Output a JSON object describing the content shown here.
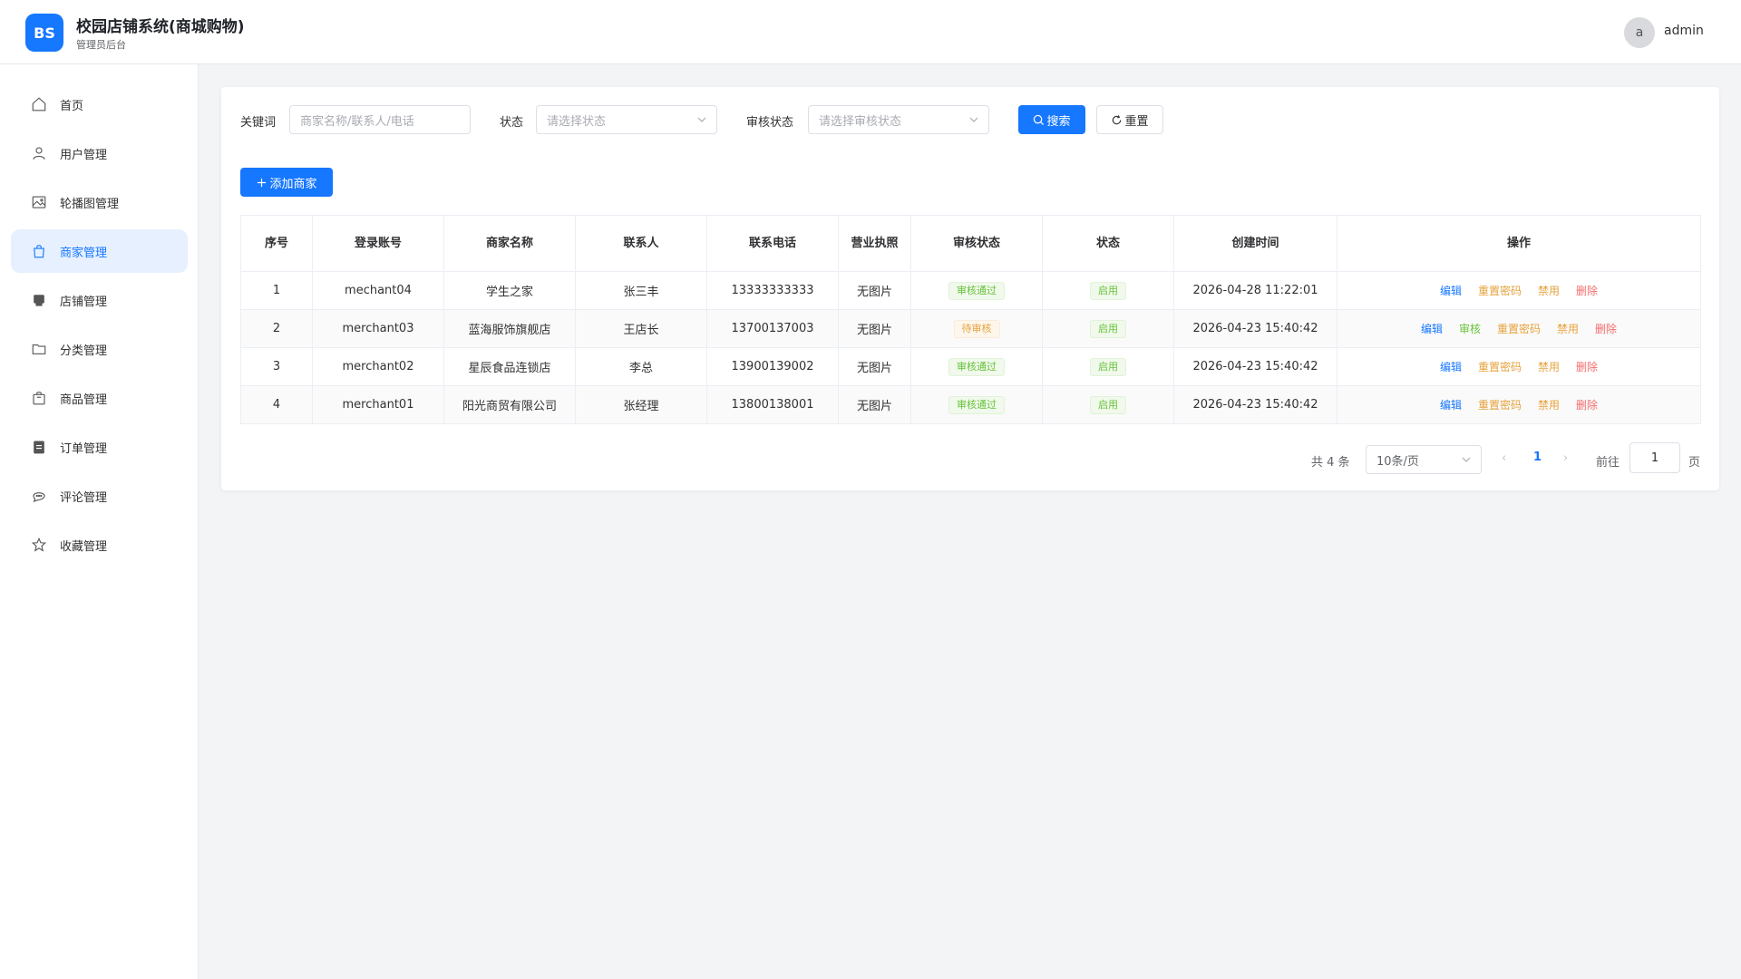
{
  "header": {
    "logo_text": "BS",
    "title": "校园店铺系统(商城购物)",
    "subtitle": "管理员后台",
    "avatar_letter": "a",
    "username": "admin"
  },
  "sidebar": {
    "items": [
      {
        "label": "首页",
        "icon": "home-icon"
      },
      {
        "label": "用户管理",
        "icon": "user-icon"
      },
      {
        "label": "轮播图管理",
        "icon": "image-icon"
      },
      {
        "label": "商家管理",
        "icon": "shopping-bag-icon",
        "active": true
      },
      {
        "label": "店铺管理",
        "icon": "shop-icon"
      },
      {
        "label": "分类管理",
        "icon": "folder-icon"
      },
      {
        "label": "商品管理",
        "icon": "goods-icon"
      },
      {
        "label": "订单管理",
        "icon": "clipboard-icon"
      },
      {
        "label": "评论管理",
        "icon": "chat-icon"
      },
      {
        "label": "收藏管理",
        "icon": "star-icon"
      }
    ]
  },
  "filters": {
    "keyword_label": "关键词",
    "keyword_placeholder": "商家名称/联系人/电话",
    "status_label": "状态",
    "status_placeholder": "请选择状态",
    "audit_label": "审核状态",
    "audit_placeholder": "请选择审核状态",
    "search_label": "搜索",
    "reset_label": "重置"
  },
  "add_button": "添加商家",
  "table": {
    "headers": [
      "序号",
      "登录账号",
      "商家名称",
      "联系人",
      "联系电话",
      "营业执照",
      "审核状态",
      "状态",
      "创建时间",
      "操作"
    ],
    "rows": [
      {
        "index": "1",
        "account": "mechant04",
        "name": "学生之家",
        "contact": "张三丰",
        "phone": "13333333333",
        "license": "无图片",
        "audit": "审核通过",
        "status": "启用",
        "created": "2026-04-28 11:22:01",
        "ops": [
          "编辑",
          "重置密码",
          "禁用",
          "删除"
        ]
      },
      {
        "index": "2",
        "account": "merchant03",
        "name": "蓝海服饰旗舰店",
        "contact": "王店长",
        "phone": "13700137003",
        "license": "无图片",
        "audit": "待审核",
        "status": "启用",
        "created": "2026-04-23 15:40:42",
        "ops": [
          "编辑",
          "审核",
          "重置密码",
          "禁用",
          "删除"
        ]
      },
      {
        "index": "3",
        "account": "merchant02",
        "name": "星辰食品连锁店",
        "contact": "李总",
        "phone": "13900139002",
        "license": "无图片",
        "audit": "审核通过",
        "status": "启用",
        "created": "2026-04-23 15:40:42",
        "ops": [
          "编辑",
          "重置密码",
          "禁用",
          "删除"
        ]
      },
      {
        "index": "4",
        "account": "merchant01",
        "name": "阳光商贸有限公司",
        "contact": "张经理",
        "phone": "13800138001",
        "license": "无图片",
        "audit": "审核通过",
        "status": "启用",
        "created": "2026-04-23 15:40:42",
        "ops": [
          "编辑",
          "重置密码",
          "禁用",
          "删除"
        ]
      }
    ]
  },
  "pagination": {
    "total": "共 4 条",
    "page_size": "10条/页",
    "current": "1",
    "goto_label": "前往",
    "goto_value": "1",
    "page_suffix": "页"
  },
  "colors": {
    "primary": "#1677ff",
    "success": "#67c23a",
    "warning": "#e6a23c",
    "danger": "#f56c6c"
  }
}
